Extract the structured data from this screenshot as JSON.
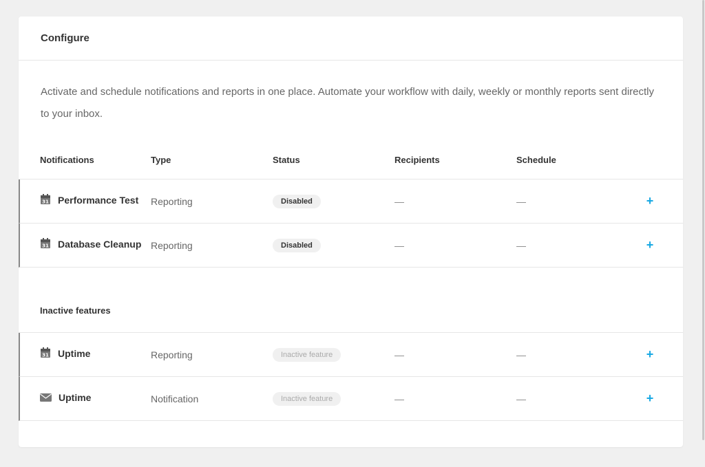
{
  "card": {
    "title": "Configure",
    "description": "Activate and schedule notifications and reports in one place. Automate your workflow with daily, weekly or monthly reports sent directly to your inbox."
  },
  "table": {
    "headers": {
      "notifications": "Notifications",
      "type": "Type",
      "status": "Status",
      "recipients": "Recipients",
      "schedule": "Schedule"
    },
    "rows": [
      {
        "name": "Performance Test",
        "icon": "calendar-icon",
        "type": "Reporting",
        "status": "Disabled",
        "recipients": "—",
        "schedule": "—",
        "add": "+"
      },
      {
        "name": "Database Cleanup",
        "icon": "calendar-icon",
        "type": "Reporting",
        "status": "Disabled",
        "recipients": "—",
        "schedule": "—",
        "add": "+"
      }
    ]
  },
  "inactive": {
    "title": "Inactive features",
    "rows": [
      {
        "name": "Uptime",
        "icon": "calendar-icon",
        "type": "Reporting",
        "status": "Inactive feature",
        "recipients": "—",
        "schedule": "—",
        "add": "+"
      },
      {
        "name": "Uptime",
        "icon": "mail-icon",
        "type": "Notification",
        "status": "Inactive feature",
        "recipients": "—",
        "schedule": "—",
        "add": "+"
      }
    ]
  },
  "colors": {
    "accent": "#17a8e3",
    "background": "#f0f0f0",
    "card": "#ffffff",
    "badge": "#f0f0f0"
  }
}
